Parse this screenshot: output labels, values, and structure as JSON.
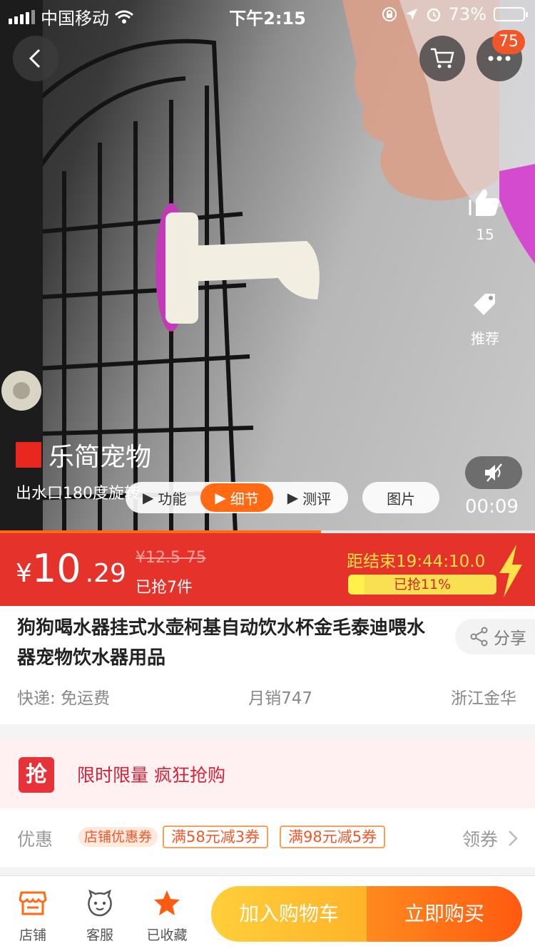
{
  "status_bar": {
    "carrier": "中国移动",
    "time": "下午2:15",
    "battery": "73%",
    "battery_level": 0.73
  },
  "top_nav": {
    "cart_badge": "75"
  },
  "side_actions": {
    "like_count": "15",
    "recommend_label": "推荐"
  },
  "video": {
    "brand": "乐简宠物",
    "caption": "出水口180度旋转",
    "tabs": [
      {
        "label": "功能",
        "active": false
      },
      {
        "label": "细节",
        "active": true
      },
      {
        "label": "测评",
        "active": false
      }
    ],
    "images_tab": "图片",
    "time": "00:09",
    "progress": 0.6
  },
  "price": {
    "currency": "¥",
    "integer": "10",
    "decimal": ".29",
    "original": "¥12.5-75",
    "sold": "已抢7件",
    "countdown": "距结束19:44:10.0",
    "grab_label": "已抢11%",
    "grab_percent": 0.11
  },
  "product": {
    "title": "狗狗喝水器挂式水壶柯基自动饮水杯金毛泰迪喂水器宠物饮水器用品",
    "share": "分享",
    "shipping": "快递: 免运费",
    "monthly_sales": "月销747",
    "location": "浙江金华"
  },
  "promo": {
    "icon_char": "抢",
    "text": "限时限量 疯狂抢购"
  },
  "coupons": {
    "label": "优惠",
    "shop_tag": "店铺优惠券",
    "items": [
      "满58元减3券",
      "满98元减5券"
    ],
    "get_label": "领券"
  },
  "bottom_bar": {
    "store": "店铺",
    "service": "客服",
    "favorite": "已收藏",
    "add_to_cart": "加入购物车",
    "buy_now": "立即购买"
  },
  "colors": {
    "accent_orange": "#ff6a12",
    "price_red": "#e5332c",
    "countdown_yellow": "#ffe24a"
  }
}
